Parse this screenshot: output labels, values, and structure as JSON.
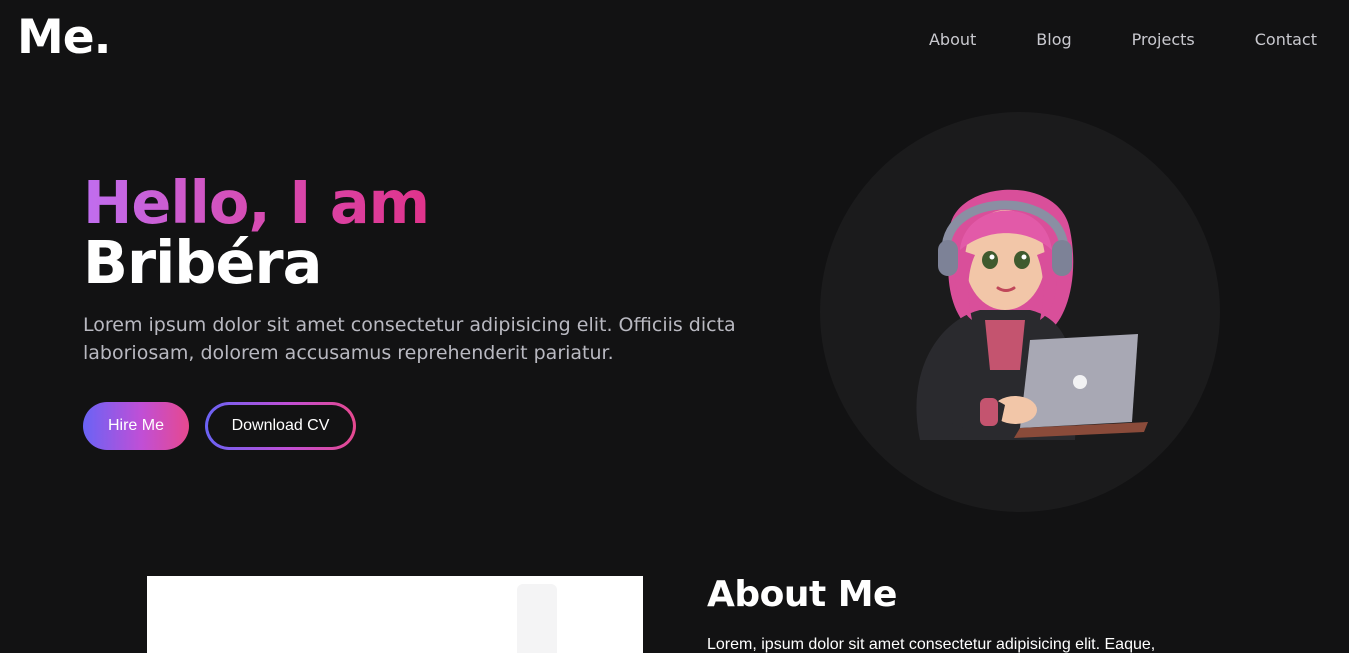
{
  "header": {
    "logo": "Me.",
    "nav": [
      "About",
      "Blog",
      "Projects",
      "Contact"
    ]
  },
  "hero": {
    "greeting": "Hello, I am",
    "name": "Bribéra",
    "intro": "Lorem ipsum dolor sit amet consectetur adipisicing elit. Officiis dicta laboriosam, dolorem accusamus reprehenderit pariatur.",
    "hire_button": "Hire Me",
    "cv_button": "Download CV",
    "avatar_icon": "avatar-girl-laptop-icon"
  },
  "about": {
    "title": "About Me",
    "text": "Lorem, ipsum dolor sit amet consectetur adipisicing elit. Eaque,"
  },
  "colors": {
    "background": "#121213",
    "gradient_start": "#6a63f5",
    "gradient_mid": "#c04fd6",
    "gradient_end": "#e6498f",
    "greeting_start": "#c06ef0",
    "greeting_end": "#e0338b"
  }
}
